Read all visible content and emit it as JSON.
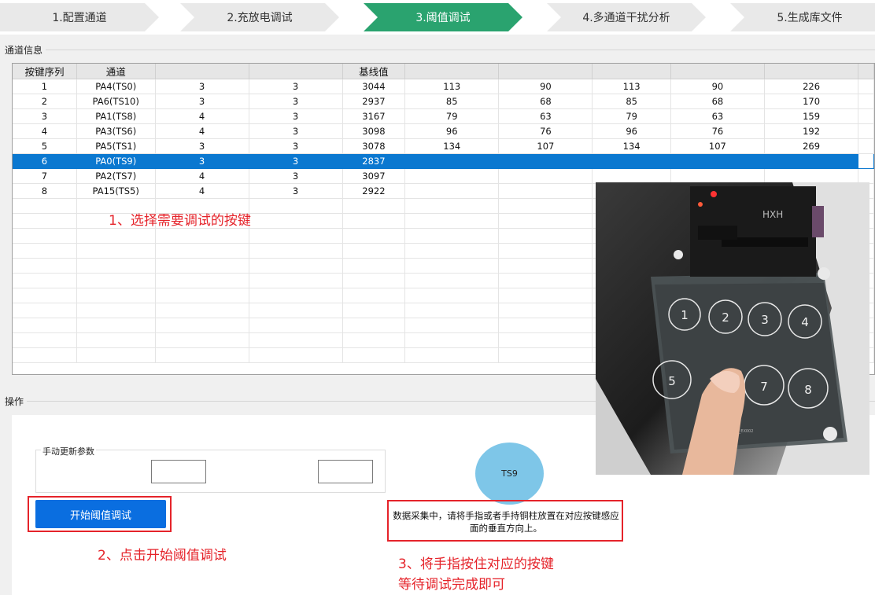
{
  "steps": [
    {
      "label": "1.配置通道",
      "active": false
    },
    {
      "label": "2.充放电调试",
      "active": false
    },
    {
      "label": "3.阈值调试",
      "active": true
    },
    {
      "label": "4.多通道干扰分析",
      "active": false
    },
    {
      "label": "5.生成库文件",
      "active": false
    }
  ],
  "colors": {
    "active_step": "#2aa36f",
    "inactive_step": "#e9e9e9",
    "selected_row": "#0b78d0",
    "annotation": "#e5232a",
    "ts_circle": "#7ec6e8",
    "button": "#0a6ee0"
  },
  "channel_section": {
    "title": "通道信息"
  },
  "table": {
    "headers": [
      "按键序列",
      "通道",
      "",
      "",
      "基线值",
      "",
      "",
      "",
      "",
      "",
      ""
    ],
    "rows": [
      [
        "1",
        "PA4(TS0)",
        "3",
        "3",
        "3044",
        "113",
        "90",
        "113",
        "90",
        "226",
        ""
      ],
      [
        "2",
        "PA6(TS10)",
        "3",
        "3",
        "2937",
        "85",
        "68",
        "85",
        "68",
        "170",
        ""
      ],
      [
        "3",
        "PA1(TS8)",
        "4",
        "3",
        "3167",
        "79",
        "63",
        "79",
        "63",
        "159",
        ""
      ],
      [
        "4",
        "PA3(TS6)",
        "4",
        "3",
        "3098",
        "96",
        "76",
        "96",
        "76",
        "192",
        ""
      ],
      [
        "5",
        "PA5(TS1)",
        "3",
        "3",
        "3078",
        "134",
        "107",
        "134",
        "107",
        "269",
        ""
      ],
      [
        "6",
        "PA0(TS9)",
        "3",
        "3",
        "2837",
        "",
        "",
        "",
        "",
        "",
        ""
      ],
      [
        "7",
        "PA2(TS7)",
        "4",
        "3",
        "3097",
        "",
        "",
        "",
        "",
        "",
        ""
      ],
      [
        "8",
        "PA15(TS5)",
        "4",
        "3",
        "2922",
        "",
        "",
        "",
        "",
        "",
        ""
      ]
    ],
    "selected_row": 5
  },
  "annotations": {
    "a1": "1、选择需要调试的按键",
    "a2": "2、点击开始阈值调试",
    "a3_line1": "3、将手指按住对应的按键",
    "a3_line2": "等待调试完成即可"
  },
  "photo": {
    "board_label": "HXH",
    "silk_text": "CH_TOUCH_Kit_EX002",
    "keys": [
      "1",
      "2",
      "3",
      "4",
      "5",
      "7",
      "8"
    ]
  },
  "operation_section": {
    "title": "操作"
  },
  "manual_group": {
    "title": "手动更新参数",
    "input1": "",
    "input2": ""
  },
  "start_button": {
    "label": "开始阈值调试"
  },
  "ts_indicator": {
    "label": "TS9"
  },
  "status": {
    "message": "数据采集中，请将手指或者手持铜柱放置在对应按键感应面的垂直方向上。"
  }
}
